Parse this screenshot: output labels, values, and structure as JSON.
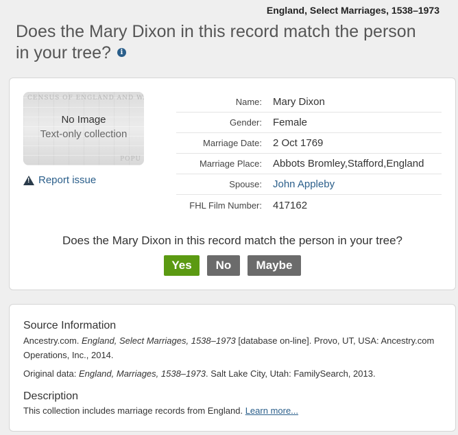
{
  "collection_title": "England, Select Marriages, 1538–1973",
  "heading": "Does the Mary Dixon in this record match the person in your tree?",
  "info_icon": "info-icon",
  "thumbnail": {
    "bg_header": "CENSUS OF ENGLAND AND WALES,",
    "bg_footer": "POPU",
    "no_image": "No Image",
    "text_only": "Text-only collection"
  },
  "report_issue": "Report issue",
  "fields": [
    {
      "label": "Name:",
      "value": "Mary Dixon"
    },
    {
      "label": "Gender:",
      "value": "Female"
    },
    {
      "label": "Marriage Date:",
      "value": "2 Oct 1769"
    },
    {
      "label": "Marriage Place:",
      "value": "Abbots Bromley,Stafford,England"
    },
    {
      "label": "Spouse:",
      "value": "John Appleby"
    },
    {
      "label": "FHL Film Number:",
      "value": "417162"
    }
  ],
  "question": "Does the Mary Dixon in this record match the person in your tree?",
  "buttons": {
    "yes": "Yes",
    "no": "No",
    "maybe": "Maybe"
  },
  "colors": {
    "yes": "#5b9a12",
    "neutral": "#6b6b6b",
    "link": "#2a5e8a"
  },
  "source": {
    "title": "Source Information",
    "line_prefix": "Ancestry.com. ",
    "line_italic": "England, Select Marriages, 1538–1973",
    "line_suffix": " [database on-line]. Provo, UT, USA: Ancestry.com Operations, Inc., 2014.",
    "orig_prefix": "Original data: ",
    "orig_italic": "England, Marriages, 1538–1973",
    "orig_suffix": ". Salt Lake City, Utah: FamilySearch, 2013."
  },
  "description": {
    "title": "Description",
    "text": "This collection includes marriage records from England. ",
    "learn_more": "Learn more..."
  }
}
